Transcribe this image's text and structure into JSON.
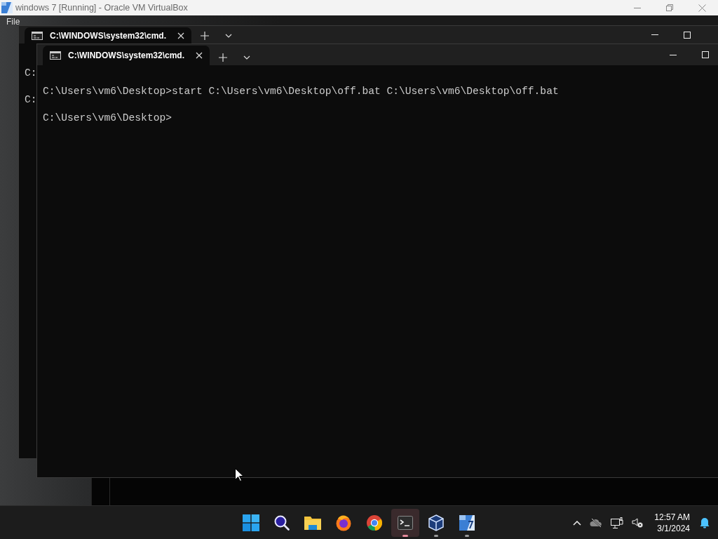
{
  "host_window": {
    "title": "windows 7 [Running] - Oracle VM VirtualBox",
    "menu": [
      "File"
    ]
  },
  "back_terminal": {
    "tabs": [
      {
        "title": "C:\\WINDOWS\\system32\\cmd.",
        "selected": true
      }
    ],
    "lines": [
      "C:",
      "C:"
    ]
  },
  "front_terminal": {
    "tabs": [
      {
        "title": "C:\\WINDOWS\\system32\\cmd.",
        "selected": true
      }
    ],
    "lines": [
      "C:\\Users\\vm6\\Desktop>start C:\\Users\\vm6\\Desktop\\off.bat C:\\Users\\vm6\\Desktop\\off.bat",
      "C:\\Users\\vm6\\Desktop>"
    ]
  },
  "taskbar": {
    "apps": [
      {
        "kind": "start",
        "running": false,
        "active": false
      },
      {
        "kind": "search",
        "running": false,
        "active": false
      },
      {
        "kind": "files",
        "running": false,
        "active": false
      },
      {
        "kind": "firefox",
        "running": false,
        "active": false
      },
      {
        "kind": "chrome",
        "running": false,
        "active": false
      },
      {
        "kind": "terminal",
        "running": true,
        "active": true
      },
      {
        "kind": "virtualbox",
        "running": true,
        "active": false
      },
      {
        "kind": "vboxvm",
        "running": true,
        "active": false
      }
    ],
    "clock": {
      "time": "12:57 AM",
      "date": "3/1/2024"
    }
  }
}
